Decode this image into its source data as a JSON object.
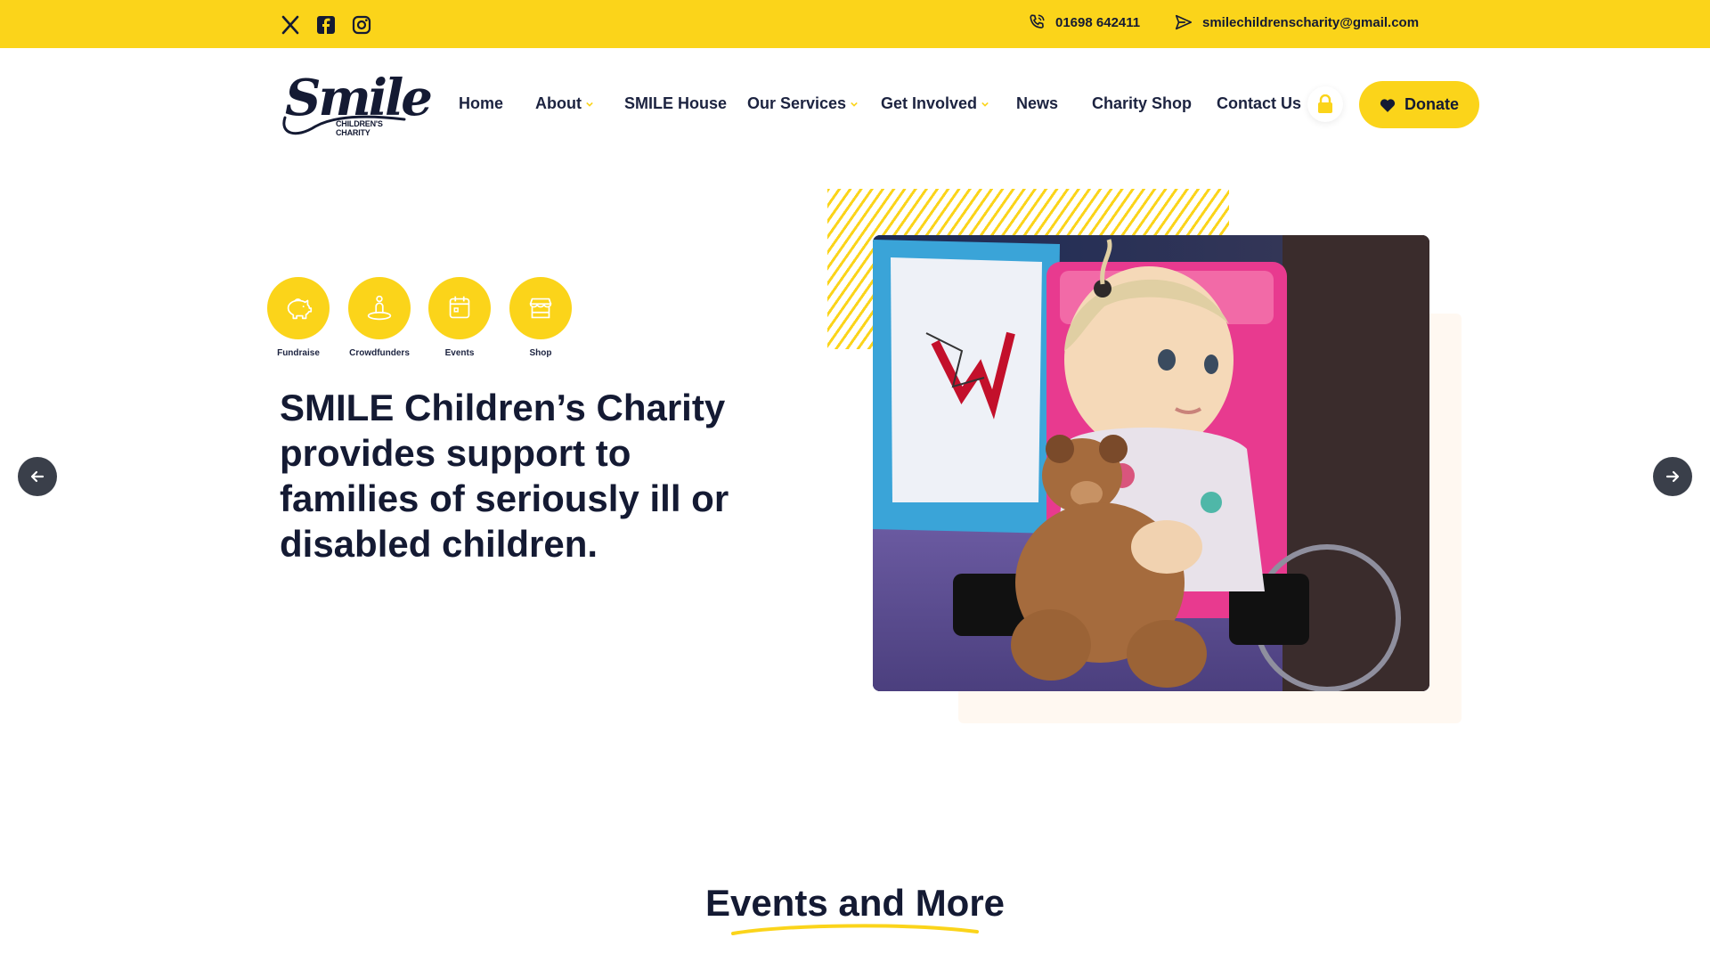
{
  "topbar": {
    "background": "#fbd41a",
    "social": [
      {
        "icon": "x-twitter-icon"
      },
      {
        "icon": "facebook-icon"
      },
      {
        "icon": "instagram-icon"
      }
    ],
    "phone": "01698 642411",
    "email": "smilechildrenscharity@gmail.com"
  },
  "logo": {
    "wordmark": "Smile",
    "subtitle": "CHILDREN'S CHARITY"
  },
  "nav": {
    "items": [
      {
        "label": "Home",
        "has_dropdown": false
      },
      {
        "label": "About",
        "has_dropdown": true
      },
      {
        "label": "SMILE House",
        "has_dropdown": false
      },
      {
        "label": "Our Services",
        "has_dropdown": true
      },
      {
        "label": "Get Involved",
        "has_dropdown": true
      },
      {
        "label": "News",
        "has_dropdown": false
      },
      {
        "label": "Charity Shop",
        "has_dropdown": false
      },
      {
        "label": "Contact Us",
        "has_dropdown": false
      }
    ],
    "lock_icon": "lock-icon",
    "donate_label": "Donate",
    "donate_icon": "heart-icon",
    "accent": "#fbd41a",
    "text_color": "#141a33"
  },
  "hero": {
    "quick_links": [
      {
        "label": "Fundraise",
        "icon": "piggy-bank-icon"
      },
      {
        "label": "Crowdfunders",
        "icon": "person-pin-icon"
      },
      {
        "label": "Events",
        "icon": "calendar-icon"
      },
      {
        "label": "Shop",
        "icon": "storefront-icon"
      }
    ],
    "headline": "SMILE Children’s Charity provides support to families of seriously ill or disabled children.",
    "prev_icon": "arrow-left-icon",
    "next_icon": "arrow-right-icon"
  },
  "events": {
    "title": "Events and More"
  }
}
